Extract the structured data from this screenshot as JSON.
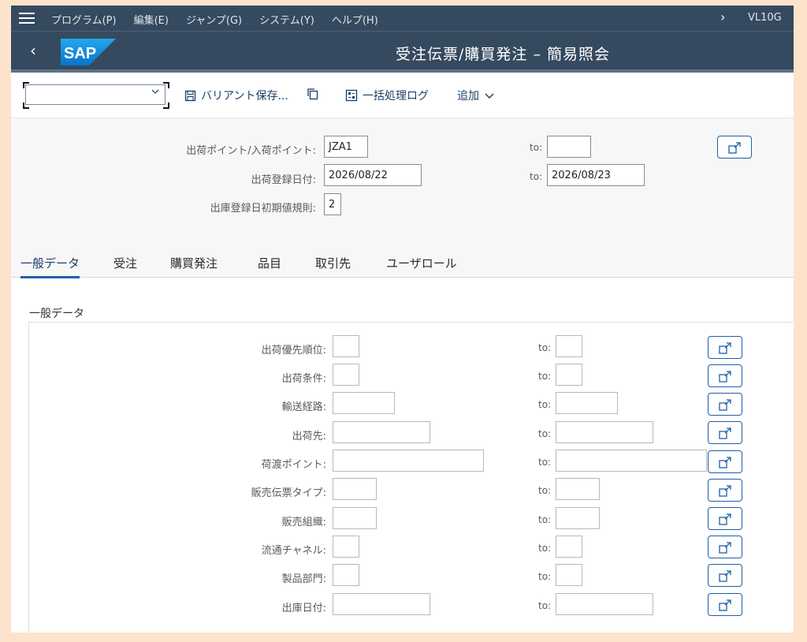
{
  "menubar": {
    "items": [
      "プログラム(P)",
      "編集(E)",
      "ジャンプ(G)",
      "システム(Y)",
      "ヘルプ(H)"
    ],
    "expand_glyph": "›",
    "tcode": "VL10G"
  },
  "titlebar": {
    "back_glyph": "‹",
    "logo_text": "SAP",
    "title": "受注伝票/購買発注 – 簡易照会"
  },
  "toolbar": {
    "variant_select_value": "",
    "variant_save_label": "バリアント保存...",
    "batch_log_label": "一括処理ログ",
    "more_label": "追加"
  },
  "selection": {
    "to_label": "to:",
    "shipping_point": {
      "label": "出荷ポイント/入荷ポイント:",
      "from": "JZA1",
      "to": ""
    },
    "delivery_date": {
      "label": "出荷登録日付:",
      "from": "2026/08/22",
      "to": "2026/08/23"
    },
    "default_rule": {
      "label": "出庫登録日初期値規則:",
      "value": "2"
    }
  },
  "tabs": [
    {
      "label": "一般データ",
      "active": true
    },
    {
      "label": "受注",
      "active": false
    },
    {
      "label": "購買発注",
      "active": false
    },
    {
      "label": "品目",
      "active": false
    },
    {
      "label": "取引先",
      "active": false
    },
    {
      "label": "ユーザロール",
      "active": false
    }
  ],
  "general": {
    "group_title": "一般データ",
    "to_label": "to:",
    "fields": [
      {
        "label": "出荷優先順位:",
        "from": "",
        "to": ""
      },
      {
        "label": "出荷条件:",
        "from": "",
        "to": ""
      },
      {
        "label": "輸送経路:",
        "from": "",
        "to": ""
      },
      {
        "label": "出荷先:",
        "from": "",
        "to": ""
      },
      {
        "label": "荷渡ポイント:",
        "from": "",
        "to": ""
      },
      {
        "label": "販売伝票タイプ:",
        "from": "",
        "to": ""
      },
      {
        "label": "販売組織:",
        "from": "",
        "to": ""
      },
      {
        "label": "流通チャネル:",
        "from": "",
        "to": ""
      },
      {
        "label": "製品部門:",
        "from": "",
        "to": ""
      },
      {
        "label": "出庫日付:",
        "from": "",
        "to": ""
      }
    ]
  },
  "colors": {
    "shell": "#354a5f",
    "accent": "#1f5fa8",
    "logo": "#1a8fd6"
  }
}
